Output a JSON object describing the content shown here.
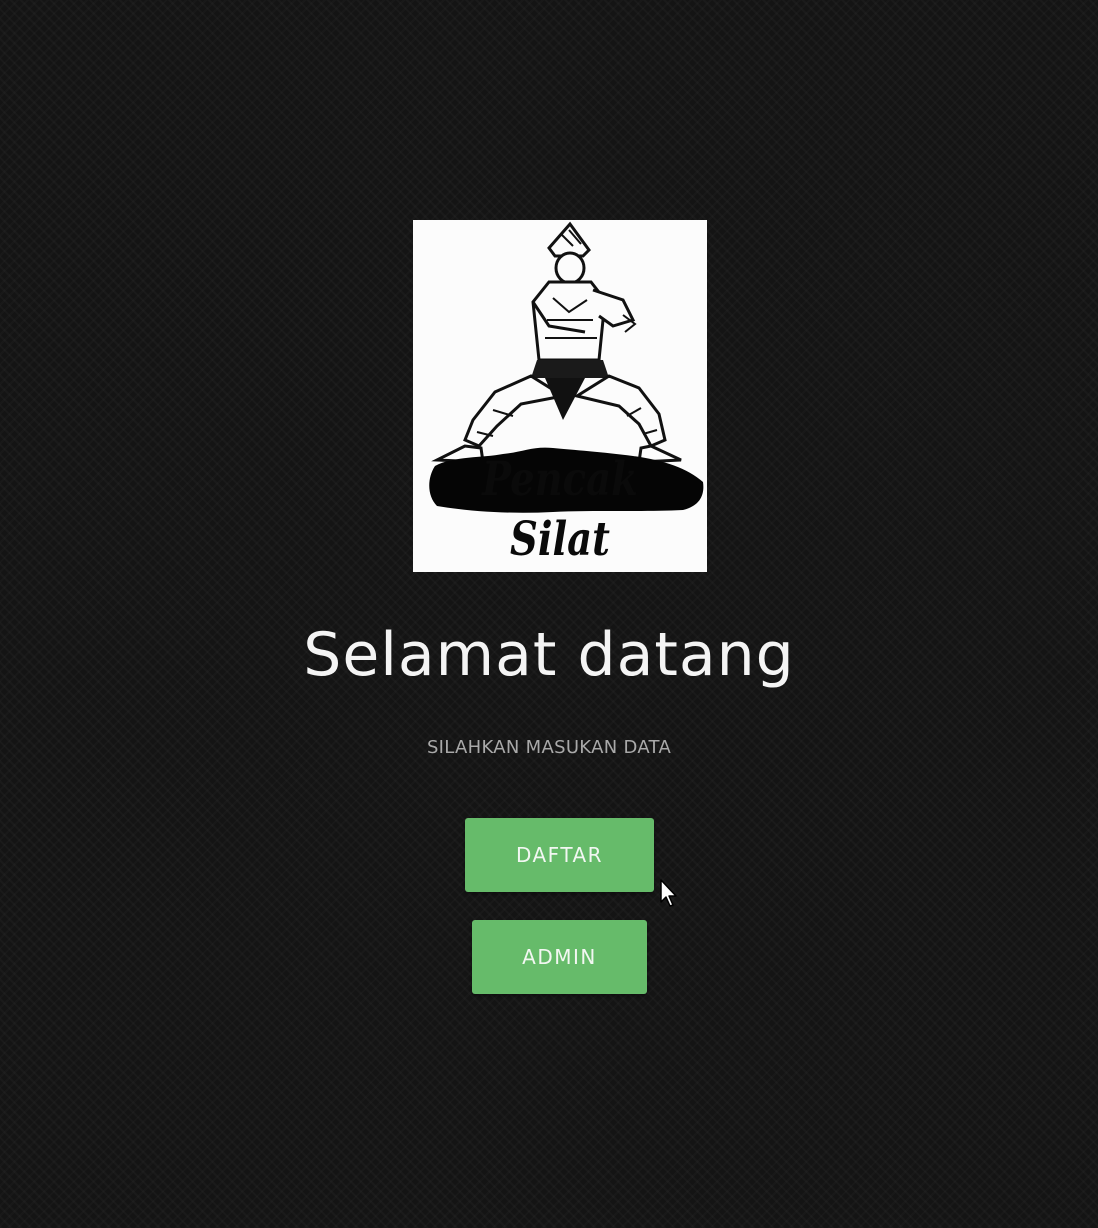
{
  "logo": {
    "text": "Pencak Silat",
    "description_icon": "pencak-silat-fighter-icon"
  },
  "header": {
    "title": "Selamat datang",
    "subtitle": "SILAHKAN MASUKAN DATA"
  },
  "actions": {
    "daftar_label": "DAFTAR",
    "admin_label": "ADMIN"
  },
  "colors": {
    "background": "#141414",
    "button": "#66bb6a",
    "title": "#f4f4f4",
    "subtitle": "#a9a9a9"
  }
}
